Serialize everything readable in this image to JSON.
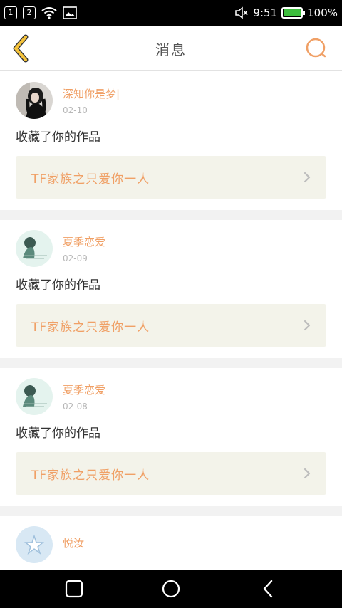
{
  "status_bar": {
    "sim1": "1",
    "sim2": "2",
    "time": "9:51",
    "battery_percent": "100%",
    "battery_level": 1.0,
    "icons": [
      "sim-1-icon",
      "sim-2-icon",
      "wifi-icon",
      "image-icon",
      "mute-icon",
      "battery-icon"
    ]
  },
  "header": {
    "title": "消息",
    "back_icon": "chevron-left-icon",
    "search_icon": "search-icon",
    "accent": "#f5c33b",
    "search_color": "#f0a066"
  },
  "messages": [
    {
      "user": "深知你是梦|",
      "date": "02-10",
      "action": "收藏了你的作品",
      "work": "TF家族之只爱你一人",
      "avatar": "dark-girl-avatar"
    },
    {
      "user": "夏季恋爱",
      "date": "02-09",
      "action": "收藏了你的作品",
      "work": "TF家族之只爱你一人",
      "avatar": "mint-girl-avatar"
    },
    {
      "user": "夏季恋爱",
      "date": "02-08",
      "action": "收藏了你的作品",
      "work": "TF家族之只爱你一人",
      "avatar": "mint-girl-avatar"
    },
    {
      "user": "悦汝",
      "date": "",
      "action": "",
      "work": "",
      "avatar": "blue-star-avatar"
    }
  ],
  "colors": {
    "username": "#f0a066",
    "date": "#b8b8b8",
    "link_bg": "#f3f3ea",
    "feed_bg": "#f2f2f2"
  },
  "nav": {
    "icons": [
      "recents-icon",
      "home-icon",
      "back-icon"
    ]
  }
}
